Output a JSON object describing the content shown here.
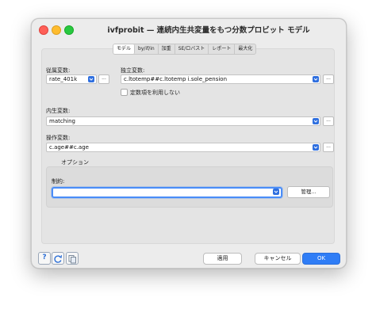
{
  "window": {
    "title": "ivfprobit — 連続内生共変量をもつ分数プロビット モデル"
  },
  "tabs": [
    "モデル",
    "by/if/in",
    "加重",
    "SE/ロバスト",
    "レポート",
    "最大化"
  ],
  "model": {
    "dependent_label": "従属変数:",
    "dependent_value": "rate_401k",
    "independent_label": "独立変数:",
    "independent_value": "c.ltotemp##c.ltotemp i.sole_pension",
    "nocons_label": "定数項を利用しない",
    "endogenous_label": "内生変数:",
    "endogenous_value": "matching",
    "instruments_label": "操作変数:",
    "instruments_value": "c.age##c.age",
    "ellipsis": "..."
  },
  "options": {
    "group_label": "オプション",
    "constraints_label": "制約:",
    "constraints_value": "",
    "manage_label": "管理..."
  },
  "footer": {
    "help_label": "?",
    "apply_label": "適用",
    "cancel_label": "キャンセル",
    "ok_label": "OK"
  },
  "colors": {
    "accent": "#2f7df6",
    "focus_ring": "#4a8df8",
    "close": "#fe5f57",
    "minimize": "#febc2e",
    "zoom": "#28c840"
  }
}
